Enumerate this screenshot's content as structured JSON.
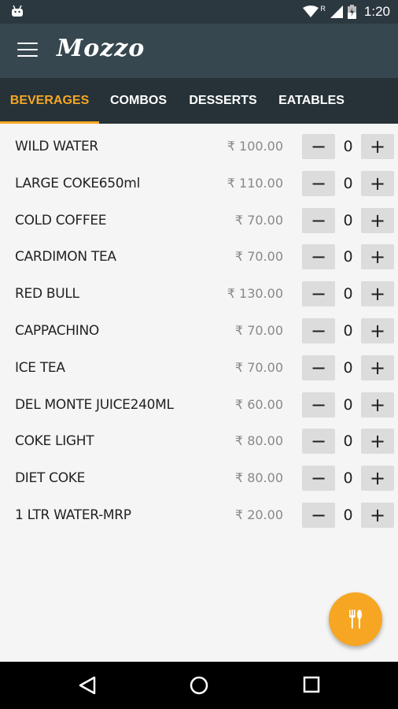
{
  "status_bar": {
    "time": "1:20",
    "network_indicator": "R"
  },
  "app_bar": {
    "title": "Mozzo"
  },
  "tabs": [
    {
      "label": "BEVERAGES",
      "active": true
    },
    {
      "label": "COMBOS",
      "active": false
    },
    {
      "label": "DESSERTS",
      "active": false
    },
    {
      "label": "EATABLES",
      "active": false
    }
  ],
  "items": [
    {
      "name": "WILD WATER",
      "price": "₹ 100.00",
      "qty": "0"
    },
    {
      "name": "LARGE COKE650ml",
      "price": "₹ 110.00",
      "qty": "0"
    },
    {
      "name": "COLD COFFEE",
      "price": "₹ 70.00",
      "qty": "0"
    },
    {
      "name": "CARDIMON TEA",
      "price": "₹ 70.00",
      "qty": "0"
    },
    {
      "name": "RED BULL",
      "price": "₹ 130.00",
      "qty": "0"
    },
    {
      "name": "CAPPACHINO",
      "price": "₹ 70.00",
      "qty": "0"
    },
    {
      "name": "ICE TEA",
      "price": "₹ 70.00",
      "qty": "0"
    },
    {
      "name": "DEL MONTE JUICE240ML",
      "price": "₹ 60.00",
      "qty": "0"
    },
    {
      "name": "COKE LIGHT",
      "price": "₹ 80.00",
      "qty": "0"
    },
    {
      "name": "DIET COKE",
      "price": "₹ 80.00",
      "qty": "0"
    },
    {
      "name": "1 LTR WATER-MRP",
      "price": "₹ 20.00",
      "qty": "0"
    }
  ],
  "buttons": {
    "minus": "−",
    "plus": "+"
  },
  "icons": {
    "menu": "hamburger-menu-icon",
    "fab": "cutlery-icon",
    "nav_back": "back-triangle-icon",
    "nav_home": "home-circle-icon",
    "nav_recents": "recents-square-icon"
  },
  "colors": {
    "accent": "#f6a623",
    "app_bar": "#37474f",
    "tab_bar": "#263238",
    "status_bar": "#2c383f",
    "background": "#f5f5f5"
  }
}
